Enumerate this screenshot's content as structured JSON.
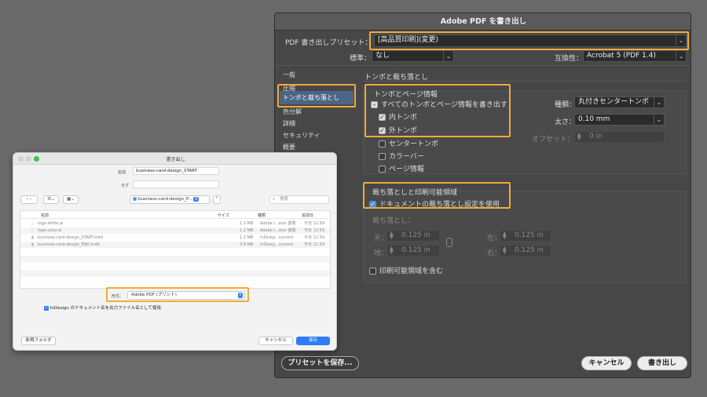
{
  "pdf_dialog": {
    "title": "Adobe PDF を書き出し",
    "preset_label": "PDF 書き出しプリセット：",
    "preset_value": "[高品質印刷](変更)",
    "standard_label": "標準：",
    "standard_value": "なし",
    "compat_label": "互換性：",
    "compat_value": "Acrobat 5 (PDF 1.4)",
    "sidebar": [
      "一般",
      "圧縮",
      "トンボと裁ち落とし",
      "色分解",
      "詳細",
      "セキュリティ",
      "概要"
    ],
    "section_title": "トンボと裁ち落とし",
    "marks": {
      "group_title": "トンボとページ情報",
      "all_marks": "すべてのトンボとページ情報を書き出す",
      "crop_inner": "内トンボ",
      "crop_outer": "外トンボ",
      "registration": "センタートンボ",
      "color_bars": "カラーバー",
      "page_info": "ページ情報",
      "type_label": "種類：",
      "type_value": "丸付きセンタートンボ",
      "weight_label": "太さ：",
      "weight_value": "0.10 mm",
      "offset_label": "オフセット：",
      "offset_value": "0 in"
    },
    "bleed": {
      "group_title": "裁ち落としと印刷可能領域",
      "use_doc": "ドキュメントの裁ち落とし設定を使用",
      "bleed_label": "裁ち落とし：",
      "top_label": "天：",
      "top_value": "0.125 in",
      "bottom_label": "地：",
      "bottom_value": "0.125 in",
      "left_label": "左：",
      "left_value": "0.125 in",
      "right_label": "右：",
      "right_value": "0.125 in",
      "slug": "印刷可能領域を含む"
    },
    "save_preset": "プリセットを保存...",
    "cancel": "キャンセル",
    "export": "書き出し"
  },
  "save_dialog": {
    "title": "書き出し",
    "name_label": "名前",
    "name_value": "business-card-design_START",
    "tags_label": "タグ",
    "location": "business-card-design_P...",
    "search_placeholder": "検索",
    "columns": [
      "名前",
      "サイズ",
      "種類",
      "追加日"
    ],
    "files": [
      {
        "name": "logo-white.ai",
        "size": "1.2 MB",
        "kind": "Adobe I...ator 書類",
        "date": "今日 11:59"
      },
      {
        "name": "logo-color.ai",
        "size": "1.2 MB",
        "kind": "Adobe I...ator 書類",
        "date": "今日 11:59"
      },
      {
        "name": "business-card-design_START.indd",
        "size": "1.2 MB",
        "kind": "InDesig...cument",
        "date": "今日 11:59"
      },
      {
        "name": "business-card-design_END.indd",
        "size": "3.9 MB",
        "kind": "InDesig...cument",
        "date": "今日 11:59"
      }
    ],
    "format_label": "形式：",
    "format_value": "Adobe PDF (プリント)",
    "use_doc_name": "InDesign のドキュメント名を出力ファイル名として使用",
    "new_folder": "新規フォルダ",
    "cancel": "キャンセル",
    "save": "保存"
  },
  "colors": {
    "highlight": "#f0ab3b",
    "primary_button": "#2f7cf6"
  }
}
